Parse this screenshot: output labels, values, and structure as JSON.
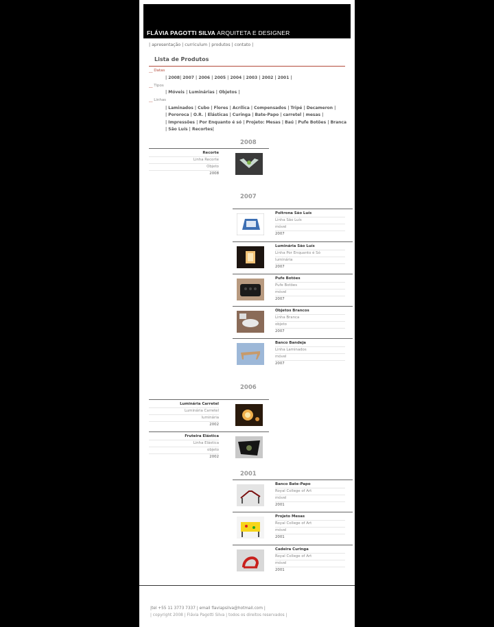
{
  "header": {
    "name": "FLÁVIA PAGOTTI SILVA",
    "subtitle": "ARQUITETA E DESIGNER"
  },
  "nav": [
    {
      "label": "apresentação"
    },
    {
      "label": "curriculum"
    },
    {
      "label": "produtos"
    },
    {
      "label": "contato"
    }
  ],
  "page_title": "Lista de Produtos",
  "filters": {
    "datas": {
      "label": "Datas",
      "line": "| 2008| 2007 | 2006 | 2005 | 2004 | 2003 | 2002 | 2001 |"
    },
    "tipos": {
      "label": "Tipos",
      "line": "| Móveis | Luminárias | Objetos |"
    },
    "linhas": {
      "label": "Linhas",
      "lines": [
        "| Laminados | Cubo | Flores | Acrílica | Compensados | Tripé | Decameron |",
        "| Pororoca | O.R. | Elásticas | Curinga | Bate-Papo | carretel | mesas |",
        "| Impressões | Por Enquanto é só | Projeto: Mesas | Baú | Pufe Botões | Branca",
        "| São Luís | Recortes|"
      ]
    }
  },
  "years": {
    "y2008": "2008",
    "y2007": "2007",
    "y2006": "2006",
    "y2001": "2001"
  },
  "products": [
    {
      "name": "Recorte",
      "line": "Linha Recorte",
      "type": "Objeto",
      "year": "2008"
    },
    {
      "name": "Poltrona São Luís",
      "line": "Linha São Luís",
      "type": "móvel",
      "year": "2007"
    },
    {
      "name": "Luminária São Luís",
      "line": "Linha Por Enquanto é Só",
      "type": "luminária",
      "year": "2007"
    },
    {
      "name": "Pufe Botões",
      "line": "Pufe Botões",
      "type": "móvel",
      "year": "2007"
    },
    {
      "name": "Objetos Brancos",
      "line": "Linha Branca",
      "type": "objeto",
      "year": "2007"
    },
    {
      "name": "Banco Bandeja",
      "line": "Linha Laminados",
      "type": "móvel",
      "year": "2007"
    },
    {
      "name": "Luminária Carretel",
      "line": "Luminária Carretel",
      "type": "luminária",
      "year": "2002"
    },
    {
      "name": "Fruteira Elástica",
      "line": "Linha Elástica",
      "type": "objeto",
      "year": "2002"
    },
    {
      "name": "Banco Bate-Papo",
      "line": "Royal College of Art",
      "type": "móvel",
      "year": "2001"
    },
    {
      "name": "Projeto Mesas",
      "line": "Royal College of Art",
      "type": "móvel",
      "year": "2001"
    },
    {
      "name": "Cadeira Curinga",
      "line": "Royal College of Art",
      "type": "móvel",
      "year": "2001"
    }
  ],
  "footer": {
    "contact": "|tel +55 11 3773 7337 | email flaviapsilva@hotmail.com |",
    "copyright": "| copyright 2008 | Flávia Pagotti Silva | todos os direitos reservados |"
  }
}
